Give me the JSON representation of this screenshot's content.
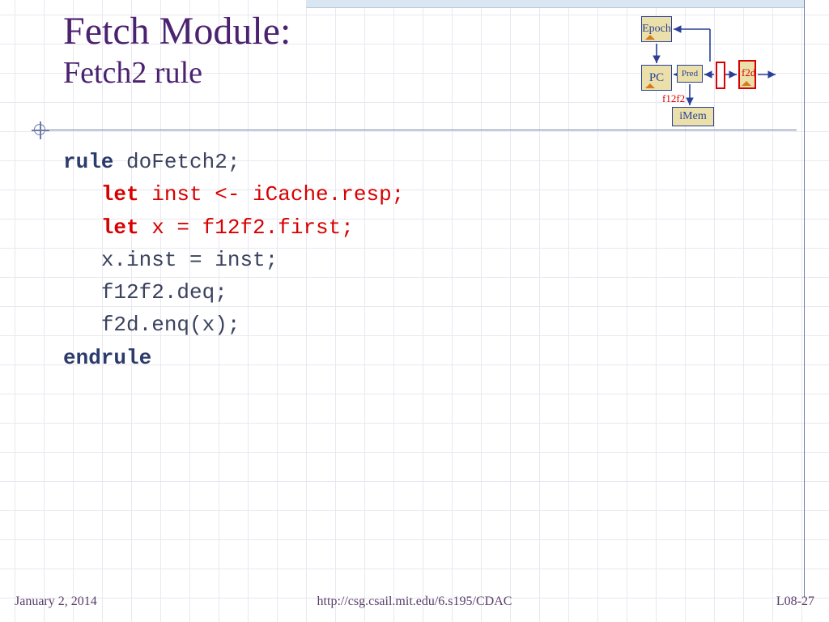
{
  "title": {
    "main": "Fetch Module:",
    "sub": "Fetch2 rule"
  },
  "code": {
    "kw_rule": "rule",
    "rule_name": " doFetch2;",
    "kw_let1": "let",
    "line2_rest": " inst <- iCache.resp;",
    "kw_let2": "let",
    "line3_rest": " x = f12f2.first;",
    "line4": "x.inst = inst;",
    "line5": "f12f2.deq;",
    "line6": "f2d.enq(x);",
    "kw_endrule": "endrule"
  },
  "diagram": {
    "epoch": "Epoch",
    "pc": "PC",
    "pred": "Pred",
    "imem": "iMem",
    "f12f2": "f12f2",
    "f2d": "f2d"
  },
  "footer": {
    "date": "January 2, 2014",
    "url": "http://csg.csail.mit.edu/6.s195/CDAC",
    "page": "L08-27"
  }
}
